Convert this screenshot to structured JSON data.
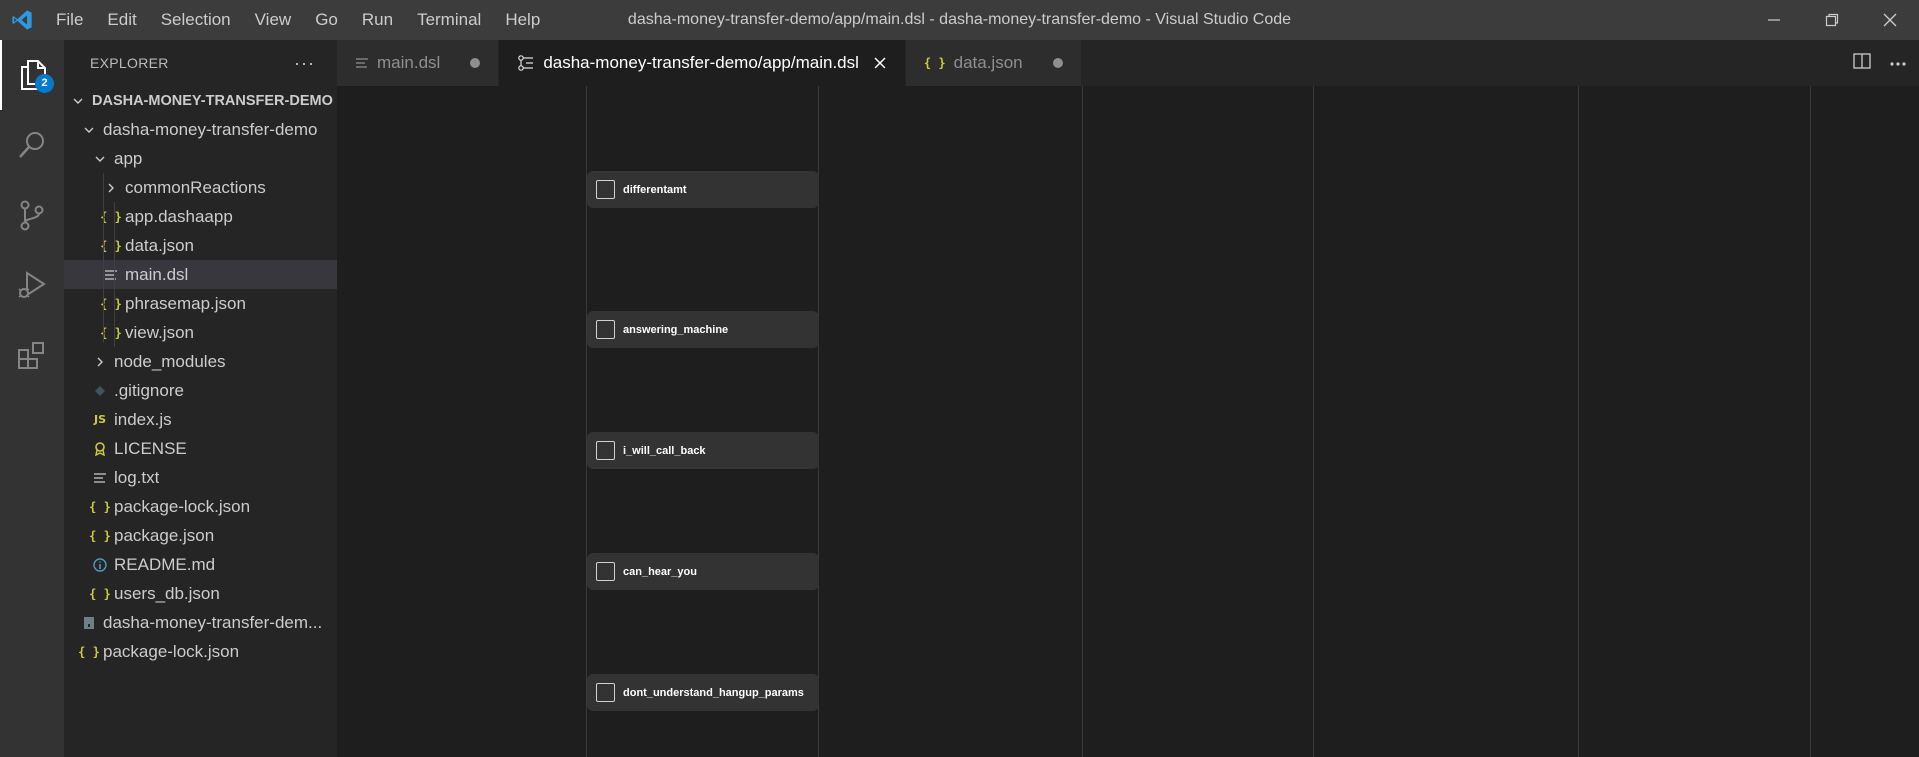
{
  "menu": [
    "File",
    "Edit",
    "Selection",
    "View",
    "Go",
    "Run",
    "Terminal",
    "Help"
  ],
  "window_title": "dasha-money-transfer-demo/app/main.dsl - dasha-money-transfer-demo - Visual Studio Code",
  "activity": {
    "explorer_badge": "2"
  },
  "sidebar": {
    "title": "EXPLORER",
    "more": "···",
    "root": "DASHA-MONEY-TRANSFER-DEMO",
    "tree": [
      {
        "label": "dasha-money-transfer-demo"
      },
      {
        "label": "app"
      },
      {
        "label": "commonReactions"
      },
      {
        "label": "app.dashaapp"
      },
      {
        "label": "data.json"
      },
      {
        "label": "main.dsl"
      },
      {
        "label": "phrasemap.json"
      },
      {
        "label": "view.json"
      },
      {
        "label": "node_modules"
      },
      {
        "label": ".gitignore"
      },
      {
        "label": "index.js"
      },
      {
        "label": "LICENSE"
      },
      {
        "label": "log.txt"
      },
      {
        "label": "package-lock.json"
      },
      {
        "label": "package.json"
      },
      {
        "label": "README.md"
      },
      {
        "label": "users_db.json"
      },
      {
        "label": "dasha-money-transfer-dem..."
      },
      {
        "label": "package-lock.json"
      }
    ],
    "icons": {
      "json": "{ }",
      "js": "JS"
    }
  },
  "tabs": [
    {
      "label": "main.dsl"
    },
    {
      "label": "dasha-money-transfer-demo/app/main.dsl"
    },
    {
      "label": "data.json"
    }
  ],
  "tab_icons": {
    "json": "{ }"
  },
  "nodes": [
    {
      "label": "differentamt"
    },
    {
      "label": "answering_machine"
    },
    {
      "label": "i_will_call_back"
    },
    {
      "label": "can_hear_you"
    },
    {
      "label": "dont_understand_hangup_params"
    }
  ]
}
